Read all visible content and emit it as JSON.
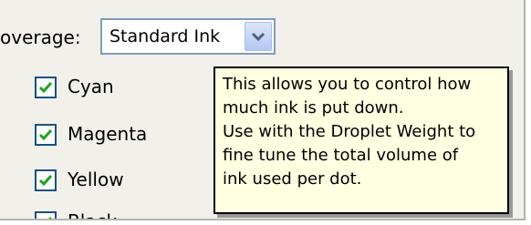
{
  "coverage": {
    "label": "overage:",
    "selected": "Standard Ink"
  },
  "channels": [
    {
      "label": "Cyan",
      "checked": true
    },
    {
      "label": "Magenta",
      "checked": true
    },
    {
      "label": "Yellow",
      "checked": true
    },
    {
      "label": "Black",
      "checked": true
    }
  ],
  "tooltip": {
    "lines": [
      "This allows you to control how",
      "much ink is put down.",
      "Use with the Droplet Weight to",
      "fine tune the total volume of",
      "ink used per dot."
    ]
  },
  "colors": {
    "panel": "#f1f0ea",
    "tooltip_bg": "#ffffe1",
    "check_mark": "#21a121",
    "select_border": "#7f9db9"
  }
}
